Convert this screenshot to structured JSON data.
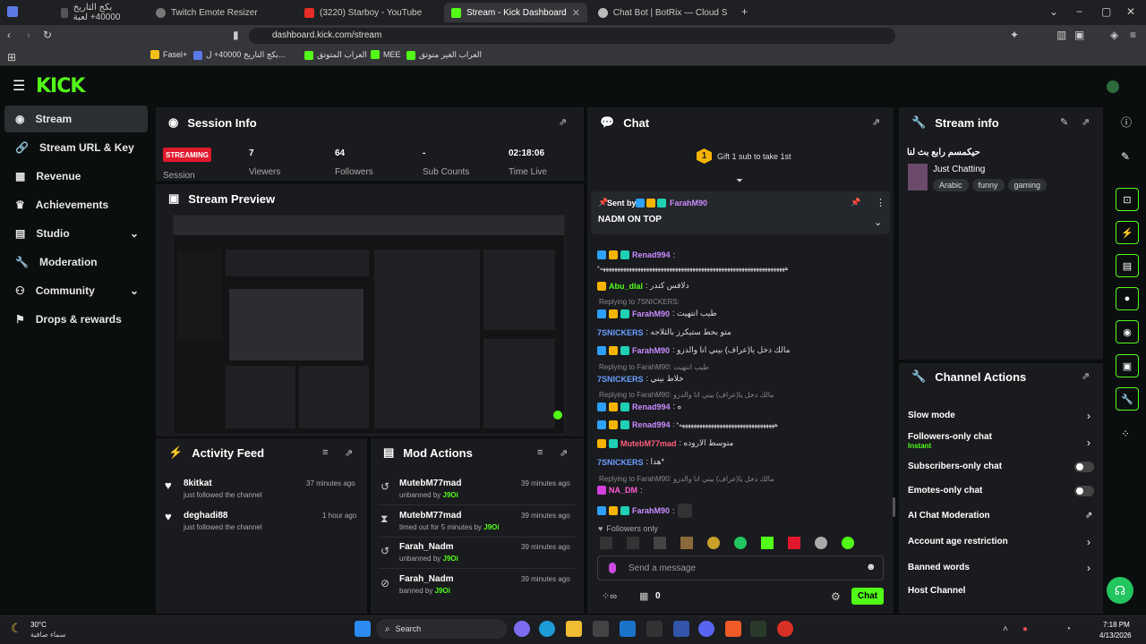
{
  "browser": {
    "tabs": [
      {
        "title": "بكج التاريخ 40000+ لعبة",
        "active": false
      },
      {
        "title": "Twitch Emote Resizer",
        "active": false
      },
      {
        "title": "(3220) Starboy - YouTube",
        "active": false
      },
      {
        "title": "Stream - Kick Dashboard",
        "active": true
      },
      {
        "title": "Chat Bot | BotRix — Cloud Streaming",
        "active": false
      }
    ],
    "url": "dashboard.kick.com/stream",
    "bookmarks": [
      "Fasel+",
      "بكج التاريخ 40000+ ل...",
      "العراب المتوتق",
      "MEE",
      "العراب الغير متوتق"
    ]
  },
  "sidebar": {
    "items": [
      {
        "label": "Stream",
        "icon": "broadcast-icon"
      },
      {
        "label": "Stream URL & Key",
        "icon": "link-icon"
      },
      {
        "label": "Revenue",
        "icon": "chart-icon"
      },
      {
        "label": "Achievements",
        "icon": "trophy-icon"
      },
      {
        "label": "Studio",
        "icon": "grid-icon"
      },
      {
        "label": "Moderation",
        "icon": "wrench-icon"
      },
      {
        "label": "Community",
        "icon": "people-icon"
      },
      {
        "label": "Drops & rewards",
        "icon": "gift-icon"
      }
    ]
  },
  "session": {
    "title": "Session Info",
    "status": "STREAMING",
    "session_label": "Session",
    "viewers_value": "7",
    "viewers_label": "Viewers",
    "followers_value": "64",
    "followers_label": "Followers",
    "subs_value": "-",
    "subs_label": "Sub Counts",
    "time_value": "02:18:06",
    "time_label": "Time Live"
  },
  "preview": {
    "title": "Stream Preview"
  },
  "activity": {
    "title": "Activity Feed",
    "items": [
      {
        "name": "8kitkat",
        "sub": "just followed the channel",
        "time": "37 minutes ago"
      },
      {
        "name": "deghadi88",
        "sub": "just followed the channel",
        "time": "1 hour ago"
      }
    ]
  },
  "mod": {
    "title": "Mod Actions",
    "items": [
      {
        "name": "MutebM77mad",
        "sub": "unbanned by",
        "by": "J9Oi",
        "time": "39 minutes ago"
      },
      {
        "name": "MutebM77mad",
        "sub": "timed out for 5 minutes by",
        "by": "J9Oi",
        "time": "39 minutes ago"
      },
      {
        "name": "Farah_Nadm",
        "sub": "unbanned by",
        "by": "J9Oi",
        "time": "39 minutes ago"
      },
      {
        "name": "Farah_Nadm",
        "sub": "banned by",
        "by": "J9Oi",
        "time": "39 minutes ago"
      }
    ]
  },
  "chat": {
    "title": "Chat",
    "gift_count": "1",
    "gift_text": "Gift 1 sub to take 1st",
    "pinned_by": "Sent by",
    "pinned_user": "FarahM90",
    "pinned_text": "NADM ON TOP",
    "lines": [
      {
        "user": "Renad994",
        "color": "#c98bff",
        "text": ":"
      },
      {
        "user": "",
        "color": "#ddd",
        "text": "*ههههههههههههههههههههههههههههههههههههههههههههههههههههههههههههههههه"
      },
      {
        "user": "Abu_dlal",
        "color": "#53fc18",
        "text": ": دلافس كندر"
      },
      {
        "user": "FarahM90",
        "color": "#c98bff",
        "text": ": طيب انتهيت"
      },
      {
        "user": "7SNICKERS",
        "color": "#6b9eff",
        "text": ": متو بحط ستيكرز بالثلاجه"
      },
      {
        "user": "FarahM90",
        "color": "#c98bff",
        "text": ": مالك دخل يا(عراف) بيني انا والدزو"
      },
      {
        "user": "7SNICKERS",
        "color": "#6b9eff",
        "text": ": خلاط بيني"
      },
      {
        "user": "Renad994",
        "color": "#c98bff",
        "text": ": ه"
      },
      {
        "user": "Renad994",
        "color": "#c98bff",
        "text": ": *هههههههههههههههههههههههههههههههههه"
      },
      {
        "user": "MutebM77mad",
        "color": "#ff5c7a",
        "text": ": متوسط الاروده"
      },
      {
        "user": "7SNICKERS",
        "color": "#6b9eff",
        "text": ": هدا*"
      },
      {
        "user": "NA_DM",
        "color": "#ff5cd6",
        "text": ":"
      },
      {
        "user": "FarahM90",
        "color": "#c98bff",
        "text": ":"
      }
    ],
    "replies": [
      "Replying to 7SNICKERS:",
      "Replying to FarahM90: طيب انتهيت",
      "Replying to FarahM90: مالك دخل يا(عراف) بيني انا والدزو",
      "Replying to FarahM90: مالك دخل يا(عراف) بيني انا والدزو"
    ],
    "followers_only": "Followers only",
    "placeholder": "Send a message",
    "points": "0",
    "send_label": "Chat"
  },
  "stream_info": {
    "title": "Stream info",
    "stream_title": "حيكمسم رابع بث لنا",
    "category": "Just Chatting",
    "tags": [
      "Arabic",
      "funny",
      "gaming"
    ]
  },
  "channel_actions": {
    "title": "Channel Actions",
    "items": [
      {
        "label": "Slow mode"
      },
      {
        "label": "Followers-only chat",
        "sub": "Instant"
      },
      {
        "label": "Subscribers-only chat"
      },
      {
        "label": "Emotes-only chat"
      },
      {
        "label": "AI Chat Moderation"
      },
      {
        "label": "Account age restriction"
      },
      {
        "label": "Banned words"
      },
      {
        "label": "Host Channel"
      }
    ]
  },
  "taskbar": {
    "weather_temp": "30°C",
    "weather_desc": "سماء صافية",
    "search": "Search",
    "time": "7:18 PM",
    "date": "4/13/2026"
  },
  "colors": {
    "accent": "#53fc18",
    "streaming": "#e0182d",
    "panel": "#191b1f",
    "background": "#0b0e0f"
  }
}
